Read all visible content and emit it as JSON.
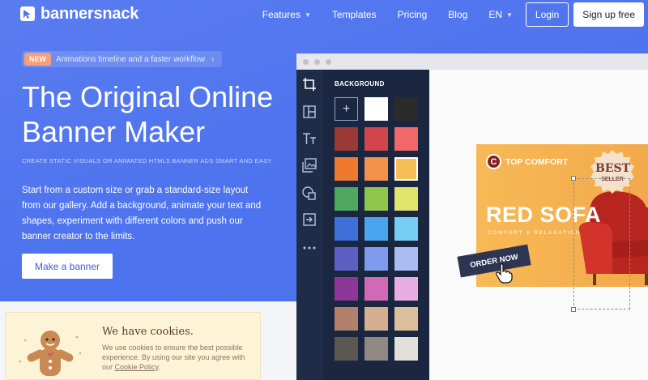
{
  "brand": {
    "name": "bannersnack"
  },
  "nav": {
    "features": "Features",
    "templates": "Templates",
    "pricing": "Pricing",
    "blog": "Blog",
    "language": "EN",
    "login": "Login",
    "signup": "Sign up free"
  },
  "hero": {
    "tag": "NEW",
    "announcement": "Animations timeline and a faster workflow",
    "title_line1": "The Original Online",
    "title_line2": "Banner Maker",
    "subtitle": "CREATE STATIC VISUALS OR ANIMATED HTML5 BANNER ADS SMART AND EASY",
    "description": "Start from a custom size or grab a standard-size layout from our gallery. Add a background, animate your text and shapes, experiment with different colors and push our banner creator to the limits.",
    "cta": "Make a banner"
  },
  "editor": {
    "panel_title": "BACKGROUND",
    "tools": [
      "crop-icon",
      "layout-icon",
      "text-icon",
      "image-icon",
      "shapes-icon",
      "import-icon",
      "more-icon"
    ],
    "swatches": [
      [
        "add",
        "#ffffff",
        "#2b2b2b"
      ],
      [
        "#9b3a34",
        "#d0464c",
        "#f0686a"
      ],
      [
        "#ee7a30",
        "#f3904a",
        "#f6bf55"
      ],
      [
        "#4fa760",
        "#8fc64b",
        "#e2e56d"
      ],
      [
        "#3f6fd8",
        "#49a6ee",
        "#77cef3"
      ],
      [
        "#5d5fc5",
        "#7f9cec",
        "#abbcf3"
      ],
      [
        "#8e3798",
        "#d16ab6",
        "#e8aee3"
      ],
      [
        "#b3816b",
        "#d4af92",
        "#dcc09c"
      ],
      [
        "#5b5753",
        "#8f8982",
        "#e2e0db"
      ]
    ],
    "selected_swatch": "#f6bf55",
    "banner": {
      "brand_initial": "C",
      "brand_name": "TOP COMFORT",
      "badge_top": "BEST",
      "badge_bottom": "SELLER",
      "title": "RED SOFA",
      "subtitle": "COMFORT & RELAXATION",
      "cta": "ORDER NOW"
    }
  },
  "cookie": {
    "title": "We have cookies.",
    "text": "We use cookies to ensure the best possible experience. By using our site you agree with our",
    "link": "Cookie Policy",
    "suffix": "."
  },
  "colors": {
    "accent": "#4d73ee",
    "editor_dark": "#1b2640",
    "banner_orange": "#f3a94b"
  }
}
